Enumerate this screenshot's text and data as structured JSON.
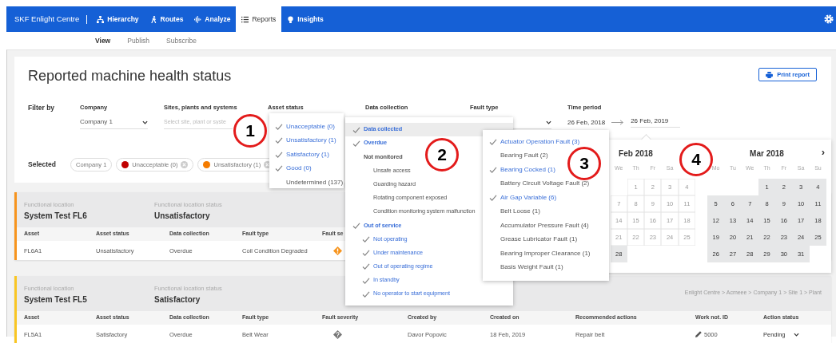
{
  "navbar": {
    "brand": "SKF Enlight Centre",
    "items": [
      {
        "label": "Hierarchy",
        "selected": false
      },
      {
        "label": "Routes",
        "selected": false
      },
      {
        "label": "Analyze",
        "selected": false
      },
      {
        "label": "Reports",
        "selected": true
      },
      {
        "label": "Insights",
        "selected": false
      }
    ]
  },
  "subnav": [
    {
      "label": "View",
      "selected": true
    },
    {
      "label": "Publish",
      "selected": false
    },
    {
      "label": "Subscribe",
      "selected": false
    }
  ],
  "report": {
    "title": "Reported machine health status",
    "print_button": "Print report"
  },
  "filters": {
    "label": "Filter by",
    "company": {
      "label": "Company",
      "value": "Company 1"
    },
    "sites": {
      "label": "Sites, plants and systems",
      "placeholder": "Select site, plant or syste"
    },
    "asset_status": {
      "label": "Asset status",
      "options": [
        {
          "label": "Unacceptable (0)",
          "checked": true
        },
        {
          "label": "Unsatisfactory (1)",
          "checked": true
        },
        {
          "label": "Satisfactory (1)",
          "checked": true
        },
        {
          "label": "Good (0)",
          "checked": true
        },
        {
          "label": "Undetermined (137)",
          "checked": false
        }
      ]
    },
    "data_collection": {
      "label": "Data collection",
      "options": [
        {
          "label": "Data collected",
          "checked": true,
          "highlighted": true
        },
        {
          "label": "Overdue",
          "checked": true,
          "highlighted": false
        },
        {
          "label": "Not monitored",
          "checked": false,
          "highlighted": false,
          "children": [
            {
              "label": "Unsafe access",
              "checked": false
            },
            {
              "label": "Guarding hazard",
              "checked": false
            },
            {
              "label": "Rotating component exposed",
              "checked": false
            },
            {
              "label": "Condition monitoring system malfunction",
              "checked": false
            }
          ]
        },
        {
          "label": "Out of service",
          "checked": true,
          "highlighted": false,
          "children": [
            {
              "label": "Not operating",
              "checked": true
            },
            {
              "label": "Under maintenance",
              "checked": true
            },
            {
              "label": "Out of operating regime",
              "checked": true
            },
            {
              "label": "In standby",
              "checked": true
            },
            {
              "label": "No operator to start equipment",
              "checked": true
            }
          ]
        }
      ]
    },
    "fault_type": {
      "label": "Fault type",
      "options": [
        {
          "label": "Actuator Operation Fault (3)",
          "checked": true
        },
        {
          "label": "Bearing Fault (2)",
          "checked": false
        },
        {
          "label": "Bearing Cocked (1)",
          "checked": true
        },
        {
          "label": "Battery Circuit Voltage Fault (2)",
          "checked": false
        },
        {
          "label": "Air Gap Variable (6)",
          "checked": true
        },
        {
          "label": "Belt Loose (1)",
          "checked": false
        },
        {
          "label": "Accumulator Pressure Fault (4)",
          "checked": false
        },
        {
          "label": "Grease Lubricator Fault (1)",
          "checked": false
        },
        {
          "label": "Bearing Improper Clearance (1)",
          "checked": false
        },
        {
          "label": "Basis Weight Fault (1)",
          "checked": false
        }
      ]
    },
    "time_period": {
      "label": "Time period",
      "from": "26 Feb, 2018",
      "to": "26 Feb, 2019"
    }
  },
  "selected": {
    "label": "Selected",
    "chips": [
      {
        "label": "Company 1"
      },
      {
        "label": "Unacceptable (0)",
        "color": "#c00000",
        "removable": true
      },
      {
        "label": "Unsatisfactory (1)",
        "color": "#f57c00",
        "removable": true
      }
    ]
  },
  "calendar": {
    "next": "›",
    "months": [
      {
        "title": "Feb 2018",
        "weekdays": [
          "We",
          "Th",
          "Fr",
          "Sa"
        ],
        "weeks": [
          [
            {
              "kind": "empty"
            },
            {
              "day": "1",
              "in_range": false
            },
            {
              "day": "2",
              "in_range": false
            },
            {
              "day": "3",
              "in_range": false
            },
            {
              "day": "4",
              "in_range": false
            }
          ],
          [
            {
              "day": "7",
              "in_range": false
            },
            {
              "day": "8",
              "in_range": false
            },
            {
              "day": "9",
              "in_range": false
            },
            {
              "day": "10",
              "in_range": false
            },
            {
              "day": "11",
              "in_range": false
            }
          ],
          [
            {
              "day": "14",
              "in_range": false
            },
            {
              "day": "15",
              "in_range": false
            },
            {
              "day": "16",
              "in_range": false
            },
            {
              "day": "17",
              "in_range": false
            },
            {
              "day": "18",
              "in_range": false
            }
          ],
          [
            {
              "day": "21",
              "in_range": false
            },
            {
              "day": "22",
              "in_range": false
            },
            {
              "day": "23",
              "in_range": false
            },
            {
              "day": "24",
              "in_range": false
            },
            {
              "day": "25",
              "in_range": false
            }
          ],
          [
            {
              "day": "28",
              "in_range": true
            }
          ]
        ]
      },
      {
        "title": "Mar 2018",
        "weekdays": [
          "Mo",
          "Tu",
          "We",
          "Th",
          "Fr",
          "Sa",
          "Su"
        ],
        "weeks": [
          [
            {
              "kind": "empty"
            },
            {
              "kind": "empty"
            },
            {
              "kind": "empty"
            },
            {
              "day": "1",
              "in_range": true
            },
            {
              "day": "2",
              "in_range": true
            },
            {
              "day": "3",
              "in_range": true
            },
            {
              "day": "4",
              "in_range": true
            }
          ],
          [
            {
              "day": "5",
              "in_range": true
            },
            {
              "day": "6",
              "in_range": true
            },
            {
              "day": "7",
              "in_range": true
            },
            {
              "day": "8",
              "in_range": true
            },
            {
              "day": "9",
              "in_range": true
            },
            {
              "day": "10",
              "in_range": true
            },
            {
              "day": "11",
              "in_range": true
            }
          ],
          [
            {
              "day": "12",
              "in_range": true
            },
            {
              "day": "13",
              "in_range": true
            },
            {
              "day": "14",
              "in_range": true
            },
            {
              "day": "15",
              "in_range": true
            },
            {
              "day": "16",
              "in_range": true
            },
            {
              "day": "17",
              "in_range": true
            },
            {
              "day": "18",
              "in_range": true
            }
          ],
          [
            {
              "day": "19",
              "in_range": true
            },
            {
              "day": "20",
              "in_range": true
            },
            {
              "day": "21",
              "in_range": true
            },
            {
              "day": "22",
              "in_range": true
            },
            {
              "day": "23",
              "in_range": true
            },
            {
              "day": "24",
              "in_range": true
            },
            {
              "day": "25",
              "in_range": true
            }
          ],
          [
            {
              "day": "26",
              "in_range": true
            },
            {
              "day": "27",
              "in_range": true
            },
            {
              "day": "28",
              "in_range": true
            },
            {
              "day": "29",
              "in_range": true
            },
            {
              "day": "30",
              "in_range": true
            },
            {
              "day": "31",
              "in_range": true
            }
          ]
        ]
      }
    ]
  },
  "groups": [
    {
      "location_label": "Functional location",
      "location": "System Test FL6",
      "status_label": "Functional location status",
      "status": "Unsatisfactory",
      "color": "#f7941d",
      "columns": [
        "Asset",
        "Asset status",
        "Data collection",
        "Fault type",
        "Fault se"
      ],
      "rows": [
        {
          "cells_before": [
            "FL6A1",
            "Unsatisfactory",
            "Overdue",
            "Coil Condition Degraded"
          ],
          "kind": "warning"
        }
      ]
    },
    {
      "location_label": "Functional location",
      "location": "System Test FL5",
      "status_label": "Functional location status",
      "status": "Satisfactory",
      "color": "#f9c623",
      "breadcrumb": "Enlight Centre > Acmeee > Company 1 > Site 1 > Plant",
      "columns": [
        "Asset",
        "Asset status",
        "Data collection",
        "Fault type",
        "Fault severity",
        "Created by",
        "Created on",
        "Recommended actions",
        "Work not. ID",
        "Action status"
      ],
      "rows": [
        {
          "cells_before": [
            "FL5A1",
            "Satisfactory",
            "Overdue",
            "Belt Wear"
          ],
          "kind": "unknown",
          "cells_after": [
            "Davor Popovic",
            "18 Feb, 2019",
            "Repair belt"
          ],
          "work_id": "5000",
          "action_status": "Pending"
        }
      ]
    }
  ],
  "callouts": [
    "1",
    "2",
    "3",
    "4"
  ]
}
